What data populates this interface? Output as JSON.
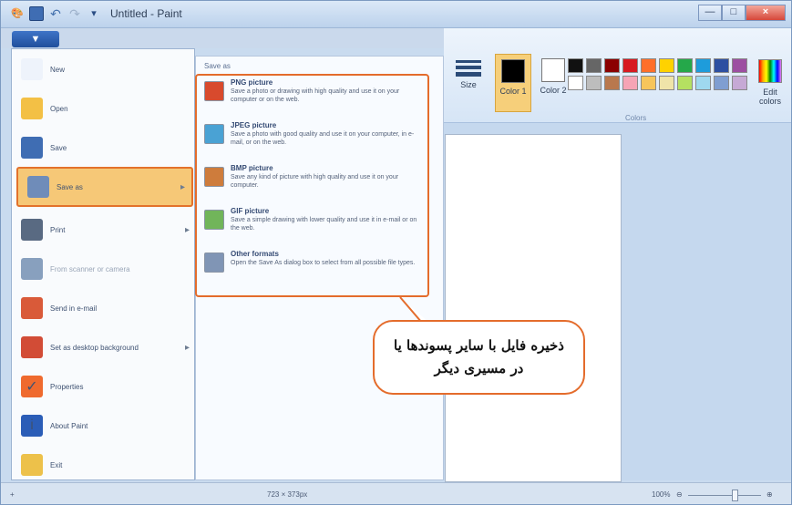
{
  "window": {
    "title": "Untitled - Paint",
    "controls": [
      "—",
      "□",
      "×"
    ]
  },
  "ribbon": {
    "file_tab": "",
    "size_label": "Size",
    "color1_label": "Color 1",
    "color2_label": "Color 2",
    "edit_colors_label": "Edit colors",
    "colors_group_label": "Colors",
    "palette": [
      "#111111",
      "#666666",
      "#8b0000",
      "#d71920",
      "#ff6f2a",
      "#ffd200",
      "#25a84a",
      "#1e9cdb",
      "#2d4fa1",
      "#9c4ea1",
      "#ffffff",
      "#bdbdbd",
      "#b9784d",
      "#f6a4b5",
      "#f7c55b",
      "#efe4a9",
      "#b5e061",
      "#9fd8ef",
      "#7f9ed1",
      "#c6a9d5"
    ]
  },
  "menu": {
    "items": [
      {
        "label": "New",
        "icon": "new-file-icon",
        "color": "#eef3fb"
      },
      {
        "label": "Open",
        "icon": "open-folder-icon",
        "color": "#f3c045"
      },
      {
        "label": "Save",
        "icon": "save-disk-icon",
        "color": "#3f6db3"
      },
      {
        "label": "Save as",
        "icon": "save-as-icon",
        "color": "#6f8cb9"
      },
      {
        "label": "Print",
        "icon": "printer-icon",
        "color": "#596a82"
      },
      {
        "label": "From scanner or camera",
        "icon": "scanner-icon",
        "color": "#88a0be"
      },
      {
        "label": "Send in e-mail",
        "icon": "email-icon",
        "color": "#d95a39"
      },
      {
        "label": "Set as desktop background",
        "icon": "desktop-background-icon",
        "color": "#d24c36"
      },
      {
        "label": "Properties",
        "icon": "check-icon",
        "color": "#ef6a2e"
      },
      {
        "label": "About Paint",
        "icon": "info-icon",
        "color": "#2b5db7"
      },
      {
        "label": "Exit",
        "icon": "exit-icon",
        "color": "#edc14a"
      }
    ]
  },
  "submenu": {
    "heading": "Save as",
    "items": [
      {
        "title": "PNG picture",
        "text": "Save a photo or drawing with high quality and use it on your computer or on the web.",
        "icon": "png-picture-icon",
        "color": "#d84a2d"
      },
      {
        "title": "JPEG picture",
        "text": "Save a photo with good quality and use it on your computer, in e-mail, or on the web.",
        "icon": "jpeg-picture-icon",
        "color": "#4aa2d4"
      },
      {
        "title": "BMP picture",
        "text": "Save any kind of picture with high quality and use it on your computer.",
        "icon": "bmp-picture-icon",
        "color": "#ce7c3c"
      },
      {
        "title": "GIF picture",
        "text": "Save a simple drawing with lower quality and use it in e-mail or on the web.",
        "icon": "gif-picture-icon",
        "color": "#71b55a"
      },
      {
        "title": "Other formats",
        "text": "Open the Save As dialog box to select from all possible file types.",
        "icon": "other-formats-icon",
        "color": "#8095b5"
      }
    ]
  },
  "callout": {
    "line1": "ذخیره فایل با سایر پسوندها یا",
    "line2": "در مسیری دیگر"
  },
  "status": {
    "plus": "+",
    "cursor": "",
    "dimensions": "723 × 373px",
    "zoom": "100%",
    "zoom_level": 0.65
  }
}
